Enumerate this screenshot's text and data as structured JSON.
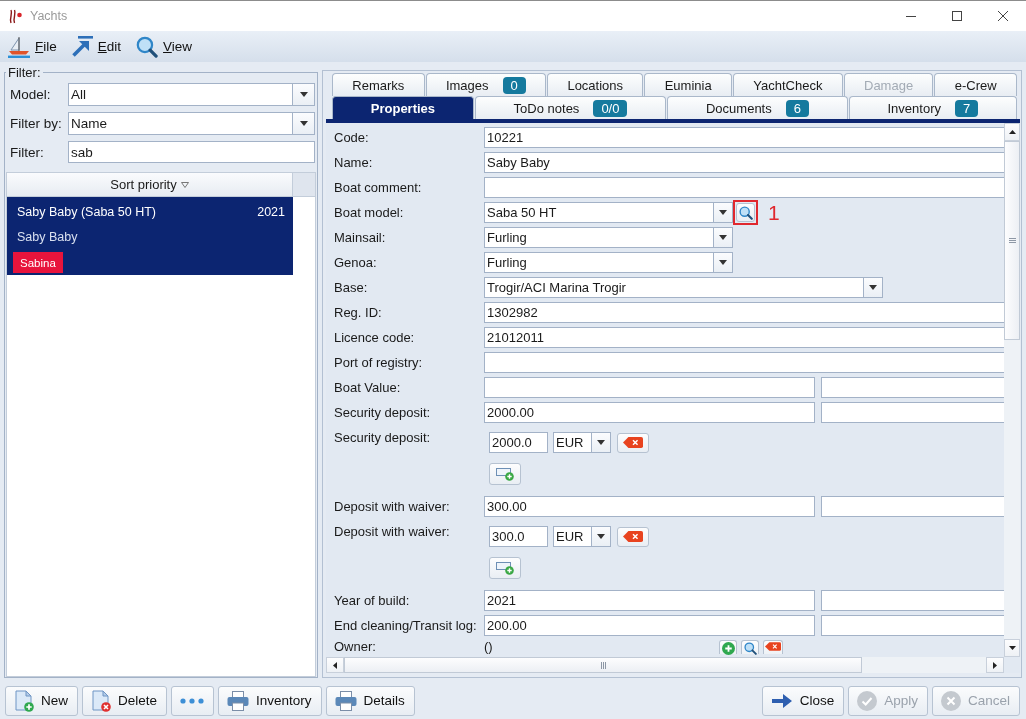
{
  "window": {
    "title": "Yachts"
  },
  "menu": [
    {
      "kind": "file",
      "label": "File"
    },
    {
      "kind": "edit",
      "label": "Edit"
    },
    {
      "kind": "view",
      "label": "View"
    }
  ],
  "filter": {
    "legend": "Filter:",
    "fields": [
      {
        "kind": "combo",
        "label": "Model:",
        "value": "All"
      },
      {
        "kind": "combo",
        "label": "Filter by:",
        "value": "Name"
      },
      {
        "kind": "text",
        "label": "Filter:",
        "value": "sab"
      }
    ]
  },
  "yacht_list": {
    "header": "Sort priority",
    "items": [
      {
        "title": "Saby Baby (Saba 50 HT)",
        "year": "2021",
        "subtitle": "Saby Baby",
        "tag": "Sabina",
        "selected": true
      }
    ]
  },
  "tab_rows": [
    {
      "tabs": [
        {
          "label": "Remarks",
          "selected": false,
          "disabled": false
        },
        {
          "label": "Images",
          "badge": "0",
          "selected": false,
          "disabled": false
        },
        {
          "label": "Locations",
          "selected": false,
          "disabled": false
        },
        {
          "label": "Euminia",
          "selected": false,
          "disabled": false
        },
        {
          "label": "YachtCheck",
          "selected": false,
          "disabled": false
        },
        {
          "label": "Damage",
          "selected": false,
          "disabled": true
        },
        {
          "label": "e-Crew",
          "selected": false,
          "disabled": false
        }
      ]
    },
    {
      "tabs": [
        {
          "label": "Properties",
          "selected": true,
          "disabled": false
        },
        {
          "label": "ToDo notes",
          "badge": "0/0",
          "selected": false,
          "disabled": false
        },
        {
          "label": "Documents",
          "badge": "6",
          "selected": false,
          "disabled": false
        },
        {
          "label": "Inventory",
          "badge": "7",
          "selected": false,
          "disabled": false
        }
      ]
    }
  ],
  "properties": {
    "rows": [
      {
        "kind": "text",
        "label": "Code:",
        "value": "10221"
      },
      {
        "kind": "text",
        "label": "Name:",
        "value": "Saby Baby"
      },
      {
        "kind": "text",
        "label": "Boat comment:"
      },
      {
        "kind": "combo",
        "label": "Boat model:",
        "value": "Saba 50 HT",
        "lookup": {
          "highlighted": true,
          "annotation": "1"
        }
      },
      {
        "kind": "combo",
        "label": "Mainsail:",
        "value": "Furling"
      },
      {
        "kind": "combo",
        "label": "Genoa:",
        "value": "Furling"
      },
      {
        "kind": "longcombo",
        "label": "Base:",
        "value": "Trogir/ACI Marina Trogir"
      },
      {
        "kind": "text",
        "label": "Reg. ID:",
        "value": "1302982"
      },
      {
        "kind": "text",
        "label": "Licence code:",
        "value": "21012011"
      },
      {
        "kind": "text",
        "label": "Port of registry:"
      },
      {
        "kind": "pair",
        "label": "Boat Value:"
      },
      {
        "kind": "pair",
        "label": "Security deposit:",
        "value": "2000.00"
      },
      {
        "kind": "money",
        "label": "Security deposit:",
        "amount": "2000.0",
        "currency": "EUR"
      },
      {
        "kind": "pair",
        "label": "Deposit with waiver:",
        "value": "300.00"
      },
      {
        "kind": "money",
        "label": "Deposit with waiver:",
        "amount": "300.0",
        "currency": "EUR"
      },
      {
        "kind": "pair",
        "label": "Year of build:",
        "value": "2021"
      },
      {
        "kind": "pair",
        "label": "End cleaning/Transit log:",
        "value": "200.00"
      },
      {
        "kind": "owner",
        "label": "Owner:",
        "value": "()"
      }
    ]
  },
  "actions": {
    "left": [
      {
        "kind": "new",
        "label": "New",
        "disabled": false
      },
      {
        "kind": "delete",
        "label": "Delete",
        "disabled": false
      },
      {
        "kind": "more",
        "disabled": false
      },
      {
        "kind": "print",
        "label": "Inventory",
        "disabled": false
      },
      {
        "kind": "print",
        "label": "Details",
        "disabled": false
      }
    ],
    "right": [
      {
        "kind": "close",
        "label": "Close",
        "disabled": false
      },
      {
        "kind": "apply",
        "label": "Apply",
        "disabled": true
      },
      {
        "kind": "cancel",
        "label": "Cancel",
        "disabled": true
      }
    ]
  }
}
